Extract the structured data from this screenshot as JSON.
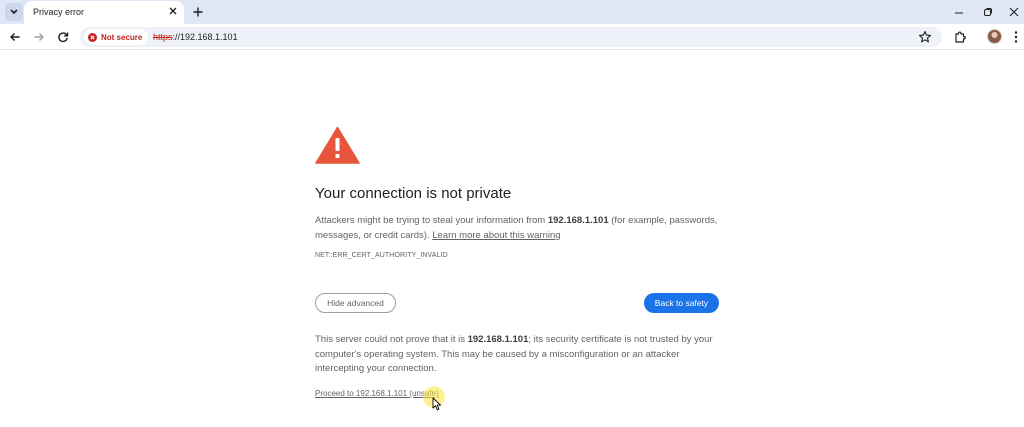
{
  "tab": {
    "title": "Privacy error"
  },
  "toolbar": {
    "security_label": "Not secure",
    "url_scheme": "https",
    "url_rest": "://192.168.1.101"
  },
  "page": {
    "heading": "Your connection is not private",
    "intro_prefix": "Attackers might be trying to steal your information from ",
    "intro_host": "192.168.1.101",
    "intro_suffix": " (for example, passwords, messages, or credit cards). ",
    "learn_more": "Learn more about this warning",
    "error_code": "NET::ERR_CERT_AUTHORITY_INVALID",
    "hide_advanced": "Hide advanced",
    "back_to_safety": "Back to safety",
    "details_prefix": "This server could not prove that it is ",
    "details_host": "192.168.1.101",
    "details_suffix": "; its security certificate is not trusted by your computer's operating system. This may be caused by a misconfiguration or an attacker intercepting your connection.",
    "proceed_link": "Proceed to 192.168.1.101 (unsafe)"
  },
  "colors": {
    "warning_red": "#e8553d",
    "primary_blue": "#1a73e8",
    "not_secure_red": "#c5221f"
  },
  "icons": [
    "tab-list-icon",
    "close-icon",
    "new-tab-icon",
    "minimize-icon",
    "restore-icon",
    "window-close-icon",
    "back-icon",
    "forward-icon",
    "reload-icon",
    "warning-icon",
    "star-icon",
    "extensions-icon",
    "profile-avatar",
    "menu-icon",
    "warning-triangle-icon",
    "cursor-icon"
  ]
}
